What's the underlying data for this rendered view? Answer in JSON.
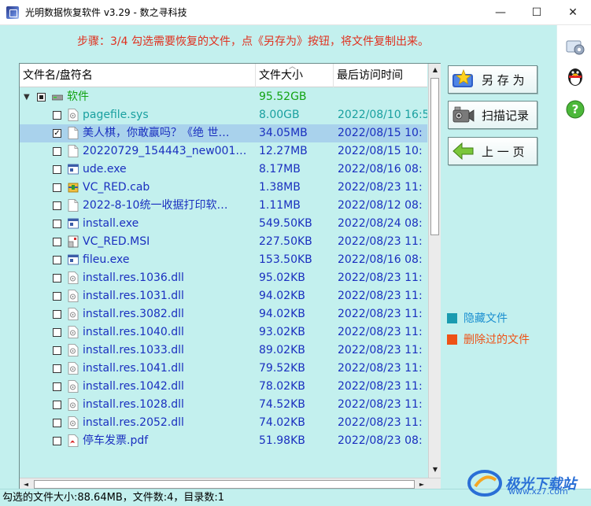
{
  "window": {
    "title": "光明数据恢复软件 v3.29 - 数之寻科技",
    "controls": {
      "minimize": "—",
      "maximize": "☐",
      "close": "✕"
    }
  },
  "step_text": "步骤：3/4 勾选需要恢复的文件，点《另存为》按钮，将文件复制出来。",
  "columns": {
    "name": "文件名/盘符名",
    "size": "文件大小",
    "time": "最后访问时间"
  },
  "rows": [
    {
      "name": "软件",
      "size": "95.52GB",
      "time": "",
      "level": 0,
      "type": "drive",
      "checked": "partial",
      "color": "#13a313"
    },
    {
      "name": "pagefile.sys",
      "size": "8.00GB",
      "time": "2022/08/10 16:5",
      "level": 1,
      "type": "sys",
      "checked": "no",
      "color": "#1aa0a0"
    },
    {
      "name": "美人棋，你敢赢吗？《绝 世…",
      "size": "34.05MB",
      "time": "2022/08/15 10:",
      "level": 1,
      "type": "doc",
      "checked": "yes",
      "color": "#1a2fbf",
      "selected": true
    },
    {
      "name": "20220729_154443_new001…",
      "size": "12.27MB",
      "time": "2022/08/15 10:",
      "level": 1,
      "type": "doc",
      "checked": "no",
      "color": "#1a2fbf"
    },
    {
      "name": "ude.exe",
      "size": "8.17MB",
      "time": "2022/08/16 08:",
      "level": 1,
      "type": "exe",
      "checked": "no",
      "color": "#1a2fbf"
    },
    {
      "name": "VC_RED.cab",
      "size": "1.38MB",
      "time": "2022/08/23 11:",
      "level": 1,
      "type": "cab",
      "checked": "no",
      "color": "#1a2fbf"
    },
    {
      "name": "2022-8-10统一收据打印软…",
      "size": "1.11MB",
      "time": "2022/08/12 08:",
      "level": 1,
      "type": "doc",
      "checked": "no",
      "color": "#1a2fbf"
    },
    {
      "name": "install.exe",
      "size": "549.50KB",
      "time": "2022/08/24 08:",
      "level": 1,
      "type": "exe",
      "checked": "no",
      "color": "#1a2fbf"
    },
    {
      "name": "VC_RED.MSI",
      "size": "227.50KB",
      "time": "2022/08/23 11:",
      "level": 1,
      "type": "msi",
      "checked": "no",
      "color": "#1a2fbf"
    },
    {
      "name": "fileu.exe",
      "size": "153.50KB",
      "time": "2022/08/16 08:",
      "level": 1,
      "type": "exe",
      "checked": "no",
      "color": "#1a2fbf"
    },
    {
      "name": "install.res.1036.dll",
      "size": "95.02KB",
      "time": "2022/08/23 11:",
      "level": 1,
      "type": "dll",
      "checked": "no",
      "color": "#1a2fbf"
    },
    {
      "name": "install.res.1031.dll",
      "size": "94.02KB",
      "time": "2022/08/23 11:",
      "level": 1,
      "type": "dll",
      "checked": "no",
      "color": "#1a2fbf"
    },
    {
      "name": "install.res.3082.dll",
      "size": "94.02KB",
      "time": "2022/08/23 11:",
      "level": 1,
      "type": "dll",
      "checked": "no",
      "color": "#1a2fbf"
    },
    {
      "name": "install.res.1040.dll",
      "size": "93.02KB",
      "time": "2022/08/23 11:",
      "level": 1,
      "type": "dll",
      "checked": "no",
      "color": "#1a2fbf"
    },
    {
      "name": "install.res.1033.dll",
      "size": "89.02KB",
      "time": "2022/08/23 11:",
      "level": 1,
      "type": "dll",
      "checked": "no",
      "color": "#1a2fbf"
    },
    {
      "name": "install.res.1041.dll",
      "size": "79.52KB",
      "time": "2022/08/23 11:",
      "level": 1,
      "type": "dll",
      "checked": "no",
      "color": "#1a2fbf"
    },
    {
      "name": "install.res.1042.dll",
      "size": "78.02KB",
      "time": "2022/08/23 11:",
      "level": 1,
      "type": "dll",
      "checked": "no",
      "color": "#1a2fbf"
    },
    {
      "name": "install.res.1028.dll",
      "size": "74.52KB",
      "time": "2022/08/23 11:",
      "level": 1,
      "type": "dll",
      "checked": "no",
      "color": "#1a2fbf"
    },
    {
      "name": "install.res.2052.dll",
      "size": "74.02KB",
      "time": "2022/08/23 11:",
      "level": 1,
      "type": "dll",
      "checked": "no",
      "color": "#1a2fbf"
    },
    {
      "name": "停车发票.pdf",
      "size": "51.98KB",
      "time": "2022/08/23 08:",
      "level": 1,
      "type": "pdf",
      "checked": "no",
      "color": "#1a2fbf"
    }
  ],
  "buttons": {
    "save_as": "另 存 为",
    "scan_log": "扫描记录",
    "prev_page": "上 一 页"
  },
  "legend": {
    "hidden": {
      "label": "隐藏文件",
      "color": "#1a9bb0"
    },
    "deleted": {
      "label": "删除过的文件",
      "color": "#ee5216"
    }
  },
  "status": "勾选的文件大小:88.64MB，文件数:4，目录数:1",
  "watermark": {
    "text": "极光下载站",
    "url": "www.xz7.com"
  },
  "side_icons": [
    "settings-gear-icon",
    "qq-penguin-icon",
    "help-question-icon"
  ]
}
